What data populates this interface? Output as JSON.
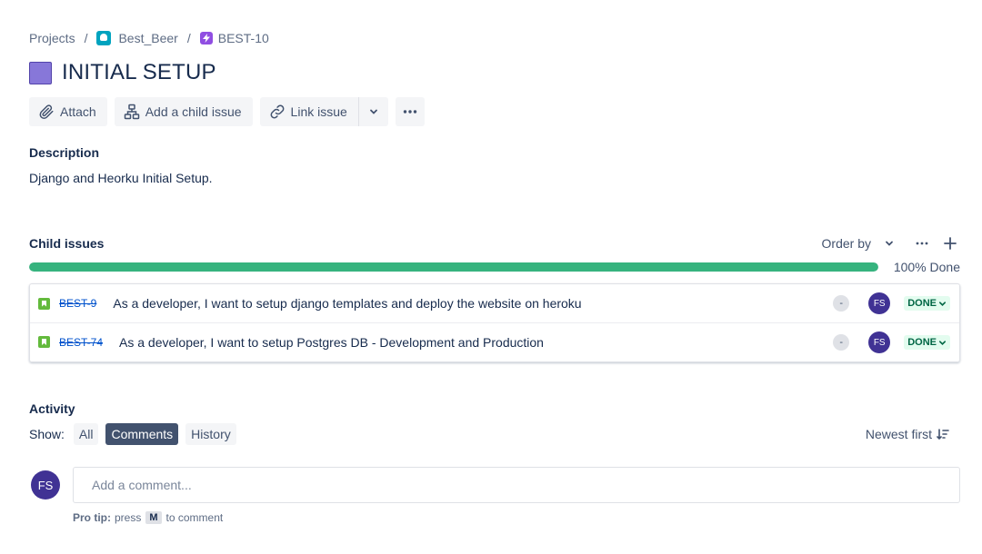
{
  "breadcrumb": {
    "projects": "Projects",
    "project": "Best_Beer",
    "issue_key": "BEST-10"
  },
  "issue": {
    "title": "INITIAL SETUP",
    "color": "#8777d9"
  },
  "toolbar": {
    "attach": "Attach",
    "add_child": "Add a child issue",
    "link_issue": "Link issue"
  },
  "description": {
    "label": "Description",
    "text": "Django and Heorku Initial Setup."
  },
  "child_issues": {
    "label": "Child issues",
    "order_by": "Order by",
    "progress_percent": 100,
    "progress_label": "100% Done",
    "progress_color": "#36b37e",
    "items": [
      {
        "key": "BEST-9",
        "summary": "As a developer, I want to setup django templates and deploy the website on heroku",
        "priority": "-",
        "assignee_initials": "FS",
        "status": "DONE"
      },
      {
        "key": "BEST-74",
        "summary": "As a developer, I want to setup Postgres DB - Development and Production",
        "priority": "-",
        "assignee_initials": "FS",
        "status": "DONE"
      }
    ]
  },
  "activity": {
    "label": "Activity",
    "show_label": "Show:",
    "filters": [
      "All",
      "Comments",
      "History"
    ],
    "active_filter": "Comments",
    "sort": "Newest first",
    "user_initials": "FS",
    "comment_placeholder": "Add a comment...",
    "protip_label": "Pro tip:",
    "protip_press": "press",
    "protip_key": "M",
    "protip_suffix": "to comment"
  }
}
